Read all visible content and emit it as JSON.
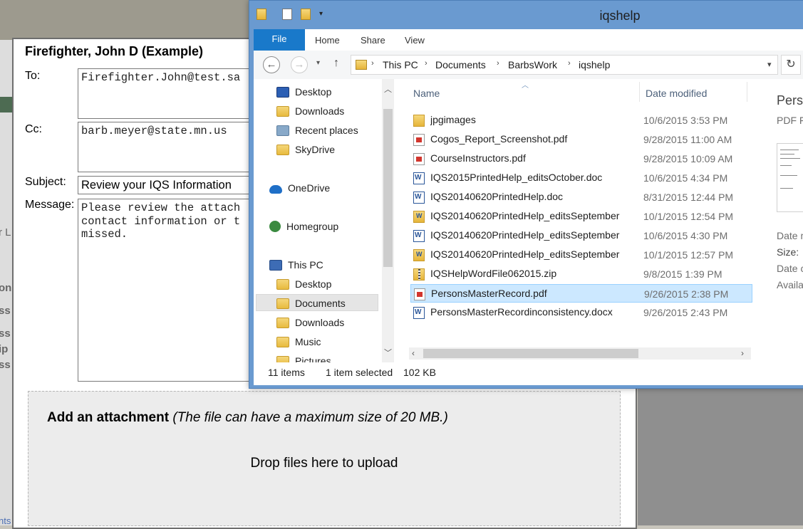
{
  "email": {
    "title": "Firefighter, John D (Example)",
    "to_label": "To:",
    "to_value": "Firefighter.John@test.sa",
    "cc_label": "Cc:",
    "cc_value": "barb.meyer@state.mn.us",
    "subject_label": "Subject:",
    "subject_value": "Review your IQS Information",
    "message_label": "Message:",
    "message_value": "Please review the attach\ncontact information or t\nmissed.",
    "attach_title": "Add an attachment",
    "attach_note": "(The file can have a maximum size of 20 MB.)",
    "drop_text": "Drop files here to upload"
  },
  "explorer": {
    "title": "iqshelp",
    "ribbon_tabs": [
      "File",
      "Home",
      "Share",
      "View"
    ],
    "breadcrumbs": [
      "This PC",
      "Documents",
      "BarbsWork",
      "iqshelp"
    ],
    "nav_items": [
      {
        "label": "Desktop",
        "icon": "desktop-icon"
      },
      {
        "label": "Downloads",
        "icon": "folder-icon"
      },
      {
        "label": "Recent places",
        "icon": "recent-icon"
      },
      {
        "label": "SkyDrive",
        "icon": "folder-icon"
      },
      {
        "label": "OneDrive",
        "icon": "cloud-icon"
      },
      {
        "label": "Homegroup",
        "icon": "homegroup-icon"
      },
      {
        "label": "This PC",
        "icon": "pc-icon"
      },
      {
        "label": "Desktop",
        "icon": "folder-icon"
      },
      {
        "label": "Documents",
        "icon": "folder-icon"
      },
      {
        "label": "Downloads",
        "icon": "folder-icon"
      },
      {
        "label": "Music",
        "icon": "folder-icon"
      },
      {
        "label": "Pictures",
        "icon": "folder-icon"
      }
    ],
    "columns": {
      "name": "Name",
      "date": "Date modified"
    },
    "files": [
      {
        "name": "jpgimages",
        "date": "10/6/2015 3:53 PM",
        "type": "folder"
      },
      {
        "name": "Cogos_Report_Screenshot.pdf",
        "date": "9/28/2015 11:00 AM",
        "type": "pdf"
      },
      {
        "name": "CourseInstructors.pdf",
        "date": "9/28/2015 10:09 AM",
        "type": "pdf"
      },
      {
        "name": "IQS2015PrintedHelp_editsOctober.doc",
        "date": "10/6/2015 4:34 PM",
        "type": "word"
      },
      {
        "name": "IQS20140620PrintedHelp.doc",
        "date": "8/31/2015 12:44 PM",
        "type": "word"
      },
      {
        "name": "IQS20140620PrintedHelp_editsSeptember",
        "date": "10/1/2015 12:54 PM",
        "type": "wordfolder"
      },
      {
        "name": "IQS20140620PrintedHelp_editsSeptember",
        "date": "10/6/2015 4:30 PM",
        "type": "word"
      },
      {
        "name": "IQS20140620PrintedHelp_editsSeptember",
        "date": "10/1/2015 12:57 PM",
        "type": "wordfolder"
      },
      {
        "name": "IQSHelpWordFile062015.zip",
        "date": "9/8/2015 1:39 PM",
        "type": "zip"
      },
      {
        "name": "PersonsMasterRecord.pdf",
        "date": "9/26/2015 2:38 PM",
        "type": "pdf",
        "selected": true
      },
      {
        "name": "PersonsMasterRecordinconsistency.docx",
        "date": "9/26/2015 2:43 PM",
        "type": "word"
      }
    ],
    "preview": {
      "title": "Perso",
      "subtitle": "PDF F",
      "details": [
        "Date m",
        "Size:",
        "Date c",
        "Availa"
      ]
    },
    "status": {
      "items": "11 items",
      "selected": "1 item selected",
      "size": "102 KB"
    }
  },
  "background": {
    "snippets": [
      "r L",
      "on",
      "ss",
      "ss",
      "ip",
      "ss",
      "nts"
    ]
  }
}
